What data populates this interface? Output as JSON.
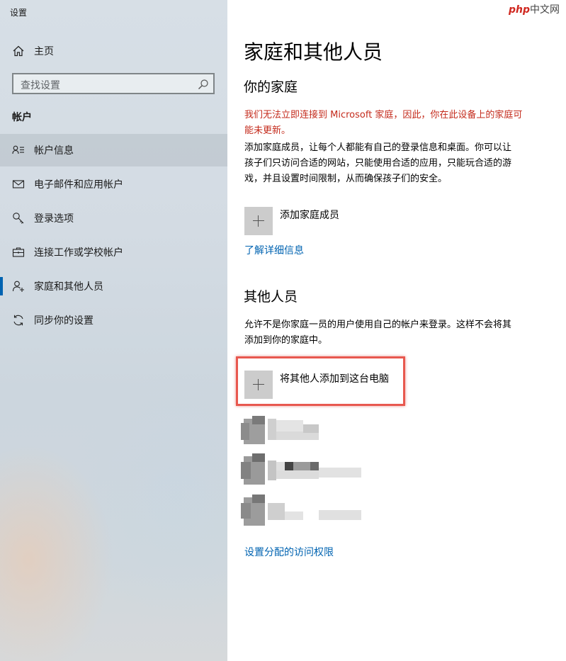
{
  "window": {
    "title": "设置"
  },
  "watermark": {
    "prefix": "php",
    "suffix": "中文网"
  },
  "sidebar": {
    "home_label": "主页",
    "search": {
      "placeholder": "查找设置"
    },
    "section_label": "帐户",
    "items": [
      {
        "label": "帐户信息",
        "icon": "account-info-icon"
      },
      {
        "label": "电子邮件和应用帐户",
        "icon": "mail-icon"
      },
      {
        "label": "登录选项",
        "icon": "key-icon"
      },
      {
        "label": "连接工作或学校帐户",
        "icon": "briefcase-icon"
      },
      {
        "label": "家庭和其他人员",
        "icon": "person-add-icon"
      },
      {
        "label": "同步你的设置",
        "icon": "sync-icon"
      }
    ],
    "selected_item": "帐户信息",
    "current_item": "家庭和其他人员"
  },
  "main": {
    "title": "家庭和其他人员",
    "family": {
      "heading": "你的家庭",
      "warning_line1": "我们无法立即连接到 Microsoft 家庭，因此，你在此设备上的家庭可",
      "warning_line2": "能未更新。",
      "desc_line1": "添加家庭成员，让每个人都能有自己的登录信息和桌面。你可以让",
      "desc_line2": "孩子们只访问合适的网站，只能使用合适的应用，只能玩合适的游",
      "desc_line3": "戏，并且设置时间限制，从而确保孩子们的安全。",
      "add_label": "添加家庭成员",
      "learn_more": "了解详细信息"
    },
    "others": {
      "heading": "其他人员",
      "desc_line1": "允许不是你家庭一员的用户使用自己的帐户来登录。这样不会将其",
      "desc_line2": "添加到你的家庭中。",
      "add_label": "将其他人添加到这台电脑",
      "user_count": 3,
      "assigned_access_link": "设置分配的访问权限"
    },
    "colors": {
      "accent": "#0063b1",
      "warning": "#c42b1c",
      "highlight": "#e8584f"
    }
  }
}
